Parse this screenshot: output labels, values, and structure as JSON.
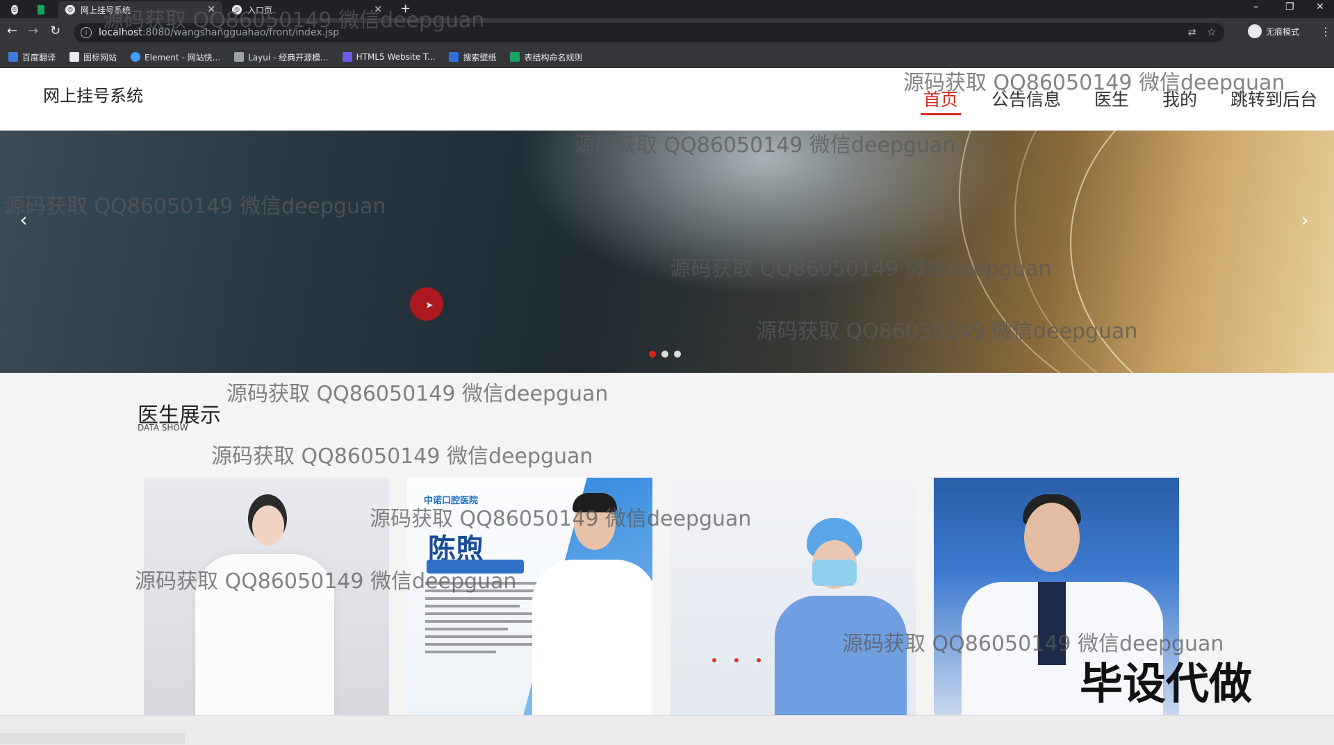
{
  "browser": {
    "tabs": [
      {
        "title": "网上挂号系统",
        "active": true
      },
      {
        "title": "入口页",
        "active": false
      }
    ],
    "url": {
      "host": "localhost",
      "path": ":8080/wangshangguahao/front/index.jsp"
    },
    "profile_label": "无痕模式",
    "bookmarks": [
      {
        "label": "百度翻译",
        "color": "#3b7ddd"
      },
      {
        "label": "图标网站",
        "color": "#e8eaed"
      },
      {
        "label": "Element - 网站快...",
        "color": "#409eff"
      },
      {
        "label": "Layui - 经典开源模...",
        "color": "#9aa0a6"
      },
      {
        "label": "HTML5 Website T...",
        "color": "#6c5ce7"
      },
      {
        "label": "搜索壁纸",
        "color": "#2f6fde"
      },
      {
        "label": "表结构命名规则",
        "color": "#1aa260"
      }
    ]
  },
  "site": {
    "title": "网上挂号系统",
    "nav": [
      {
        "label": "首页",
        "active": true
      },
      {
        "label": "公告信息",
        "active": false
      },
      {
        "label": "医生",
        "active": false
      },
      {
        "label": "我的",
        "active": false
      },
      {
        "label": "跳转到后台",
        "active": false
      }
    ],
    "accent_color": "#d4281c"
  },
  "banner": {
    "slide_count": 3,
    "active_slide": 1
  },
  "doctors_section": {
    "title": "医生展示",
    "subtitle": "DATA SHOW",
    "poster": {
      "hospital": "中诺口腔医院",
      "name": "陈煦"
    }
  },
  "watermark": {
    "text": "源码获取 QQ86050149 微信deepguan",
    "corner_text": "毕设代做"
  }
}
